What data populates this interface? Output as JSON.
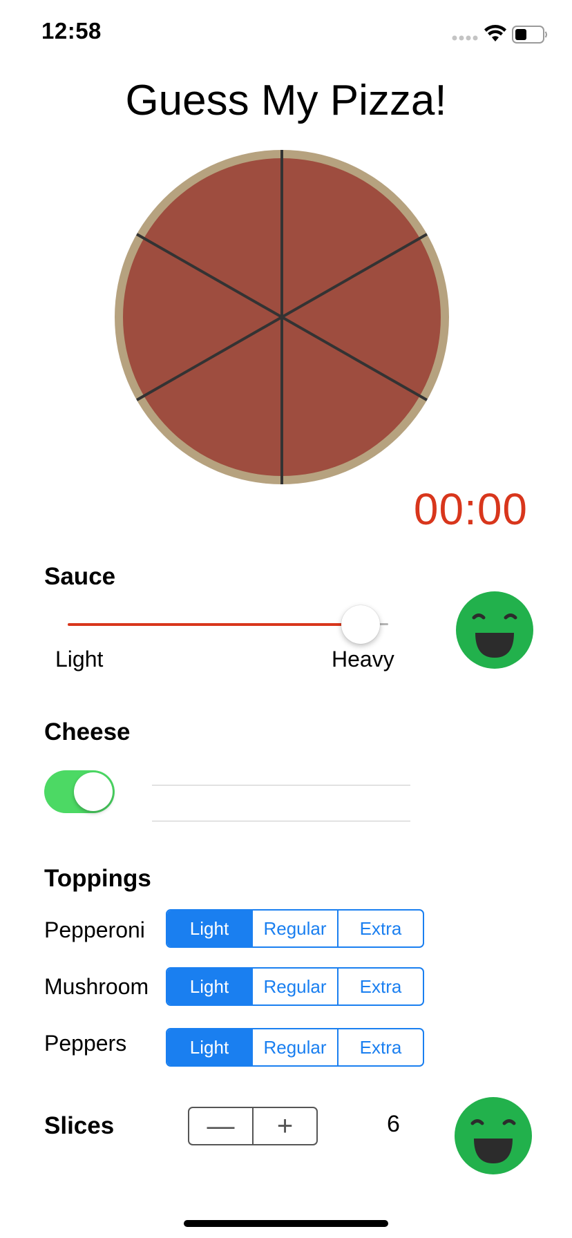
{
  "status_bar": {
    "time": "12:58",
    "icons": [
      "signal-dots-icon",
      "wifi-icon",
      "battery-icon"
    ]
  },
  "title": "Guess My Pizza!",
  "pizza": {
    "sauce_color": "#9e4d3f",
    "crust_color": "#b6a27f",
    "cut_color": "#333333",
    "slice_count": 6
  },
  "timer": "00:00",
  "sauce": {
    "label": "Sauce",
    "min_label": "Light",
    "max_label": "Heavy",
    "value_fraction": 0.9,
    "track_color": "#d8361c"
  },
  "cheese": {
    "label": "Cheese",
    "toggle_on": true
  },
  "toppings": {
    "label": "Toppings",
    "items": [
      {
        "name": "Pepperoni",
        "options": [
          "Light",
          "Regular",
          "Extra"
        ],
        "selected": "Light"
      },
      {
        "name": "Mushroom",
        "options": [
          "Light",
          "Regular",
          "Extra"
        ],
        "selected": "Light"
      },
      {
        "name": "Peppers",
        "options": [
          "Light",
          "Regular",
          "Extra"
        ],
        "selected": "Light"
      }
    ]
  },
  "slices": {
    "label": "Slices",
    "minus": "—",
    "plus": "+",
    "value": "6"
  },
  "colors": {
    "accent": "#1a7ff0",
    "timer": "#d8361c",
    "toggle_on": "#4cd964",
    "smiley": "#22b14c"
  }
}
